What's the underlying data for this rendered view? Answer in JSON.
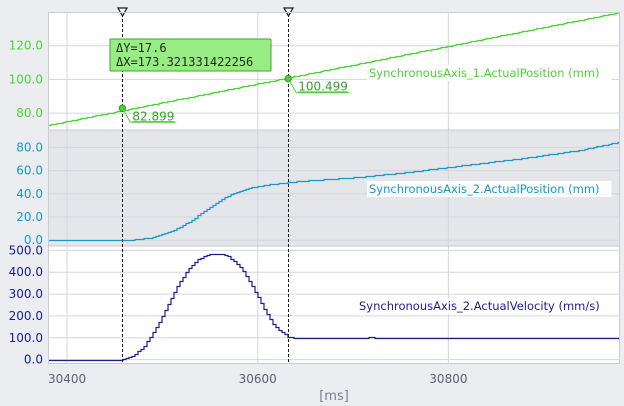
{
  "app": {
    "x_unit_label": "[ms]"
  },
  "colors": {
    "series1": "#4ed239",
    "series2": "#1a98c6",
    "series3": "#1a1f8f",
    "cursor": "#1a1a1a",
    "band_shade": "#e4e6ea",
    "grid": "#d4d6dc",
    "measure_box": "#98ec84",
    "measure_border": "#3aa82b"
  },
  "measurement": {
    "delta_y": "ΔY=17.6",
    "delta_x": "ΔX=173.321331422256"
  },
  "chart_data": {
    "type": "line",
    "x_unit": "ms",
    "xlim": [
      30380,
      30980
    ],
    "x_ticks": [
      {
        "value": 30400,
        "label": "30400"
      },
      {
        "value": 30600,
        "label": "30600"
      },
      {
        "value": 30800,
        "label": "30800"
      }
    ],
    "cursors": [
      {
        "name": "cursor-1",
        "x": 30458
      },
      {
        "name": "cursor-2",
        "x": 30632
      }
    ],
    "bands": [
      {
        "name": "axis-1-position",
        "ylim": [
          70,
          140
        ],
        "y_ticks": [
          {
            "value": 80,
            "label": "80.0"
          },
          {
            "value": 100,
            "label": "100.0"
          },
          {
            "value": 120,
            "label": "120.0"
          }
        ],
        "series": [
          {
            "name": "SynchronousAxis_1.ActualPosition (mm)",
            "color": "#4ed239",
            "style": "stair",
            "points": [
              [
                30380,
                73.0
              ],
              [
                30980,
                140.0
              ]
            ]
          }
        ],
        "value_labels": [
          {
            "x": 30458,
            "y": 82.899,
            "label": "82.899"
          },
          {
            "x": 30632,
            "y": 100.499,
            "label": "100.499"
          }
        ]
      },
      {
        "name": "axis-2-position",
        "ylim": [
          -5,
          95
        ],
        "y_ticks": [
          {
            "value": 0,
            "label": "0.0"
          },
          {
            "value": 20,
            "label": "20.0"
          },
          {
            "value": 40,
            "label": "40.0"
          },
          {
            "value": 60,
            "label": "60.0"
          },
          {
            "value": 80,
            "label": "80.0"
          }
        ],
        "series": [
          {
            "name": "SynchronousAxis_2.ActualPosition (mm)",
            "color": "#1a98c6",
            "style": "stair",
            "points": [
              [
                30380,
                0
              ],
              [
                30458,
                0
              ],
              [
                30470,
                0.5
              ],
              [
                30490,
                2.5
              ],
              [
                30510,
                8
              ],
              [
                30530,
                17
              ],
              [
                30550,
                29
              ],
              [
                30570,
                39
              ],
              [
                30590,
                45
              ],
              [
                30610,
                48
              ],
              [
                30632,
                50
              ],
              [
                30660,
                52
              ],
              [
                30700,
                54
              ],
              [
                30760,
                59
              ],
              [
                30820,
                65
              ],
              [
                30880,
                71
              ],
              [
                30940,
                78
              ],
              [
                30980,
                85
              ]
            ]
          }
        ]
      },
      {
        "name": "axis-2-velocity",
        "ylim": [
          -20,
          520
        ],
        "y_ticks": [
          {
            "value": 0,
            "label": "0.0"
          },
          {
            "value": 100,
            "label": "100.0"
          },
          {
            "value": 200,
            "label": "200.0"
          },
          {
            "value": 300,
            "label": "300.0"
          },
          {
            "value": 400,
            "label": "400.0"
          },
          {
            "value": 500,
            "label": "500.0"
          }
        ],
        "series": [
          {
            "name": "SynchronousAxis_2.ActualVelocity (mm/s)",
            "color": "#1a1f8f",
            "style": "stair",
            "points": [
              [
                30380,
                0
              ],
              [
                30458,
                0
              ],
              [
                30465,
                10
              ],
              [
                30472,
                30
              ],
              [
                30480,
                60
              ],
              [
                30488,
                110
              ],
              [
                30496,
                170
              ],
              [
                30504,
                240
              ],
              [
                30512,
                310
              ],
              [
                30520,
                370
              ],
              [
                30528,
                420
              ],
              [
                30536,
                455
              ],
              [
                30544,
                475
              ],
              [
                30552,
                485
              ],
              [
                30560,
                485
              ],
              [
                30568,
                475
              ],
              [
                30576,
                450
              ],
              [
                30584,
                410
              ],
              [
                30592,
                350
              ],
              [
                30600,
                290
              ],
              [
                30608,
                220
              ],
              [
                30616,
                165
              ],
              [
                30624,
                130
              ],
              [
                30632,
                105
              ],
              [
                30640,
                97
              ],
              [
                30660,
                98
              ],
              [
                30700,
                99
              ],
              [
                30720,
                102
              ],
              [
                30730,
                99
              ],
              [
                30980,
                100
              ]
            ]
          }
        ]
      }
    ]
  }
}
